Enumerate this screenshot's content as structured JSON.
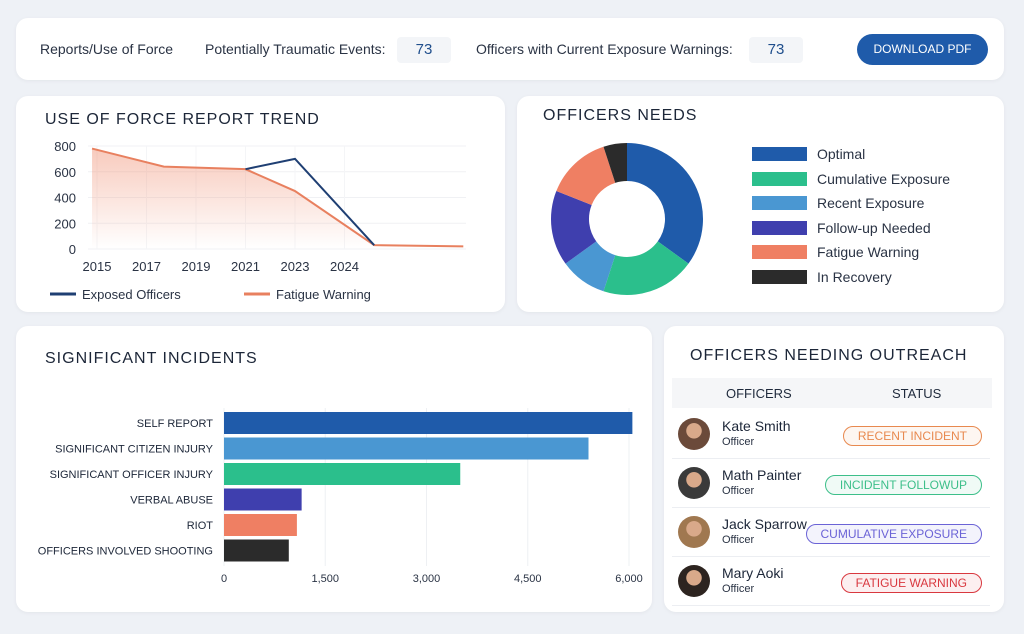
{
  "header": {
    "label": "Reports/Use of Force",
    "pte_label": "Potentially Traumatic Events:",
    "pte_value": "73",
    "exposure_label": "Officers with Current Exposure Warnings:",
    "exposure_value": "73",
    "download_label": "DOWNLOAD PDF"
  },
  "trend": {
    "title": "USE OF FORCE REPORT TREND"
  },
  "needs": {
    "title": "OFFICERS NEEDS"
  },
  "incidents": {
    "title": "SIGNIFICANT INCIDENTS"
  },
  "outreach": {
    "title": "OFFICERS NEEDING OUTREACH",
    "col_officers": "OFFICERS",
    "col_status": "STATUS",
    "rows": [
      {
        "name": "Kate Smith",
        "role": "Officer",
        "status": "RECENT INCIDENT",
        "color": "#e8894f"
      },
      {
        "name": "Math Painter",
        "role": "Officer",
        "status": "INCIDENT FOLLOWUP",
        "color": "#3dbf8a"
      },
      {
        "name": "Jack Sparrow",
        "role": "Officer",
        "status": "CUMULATIVE EXPOSURE",
        "color": "#6b63d6"
      },
      {
        "name": "Mary Aoki",
        "role": "Officer",
        "status": "FATIGUE WARNING",
        "color": "#d9383f"
      }
    ]
  },
  "chart_data": [
    {
      "type": "line",
      "x_tick_labels": [
        "2015",
        "2017",
        "2019",
        "2021",
        "2023",
        "2024"
      ],
      "ylim": [
        0,
        800
      ],
      "y_ticks": [
        0,
        200,
        400,
        600,
        800
      ],
      "legend": "bottom",
      "series": [
        {
          "name": "Exposed Officers",
          "color": "#1f3f73",
          "points": [
            [
              3,
              620
            ],
            [
              4,
              700
            ],
            [
              5.6,
              30
            ]
          ]
        },
        {
          "name": "Fatigue Warning",
          "color": "#e8805f",
          "area": true,
          "points": [
            [
              -0.1,
              780
            ],
            [
              1.35,
              640
            ],
            [
              3,
              620
            ],
            [
              4,
              450
            ],
            [
              5.6,
              30
            ],
            [
              7.4,
              20
            ]
          ]
        }
      ]
    },
    {
      "type": "pie",
      "donut": true,
      "legend": "right",
      "categories": [
        "Optimal",
        "Cumulative Exposure",
        "Recent Exposure",
        "Follow-up Needed",
        "Fatigue Warning",
        "In Recovery"
      ],
      "values": [
        35,
        20,
        10,
        16,
        14,
        5
      ],
      "colors": [
        "#1f5baa",
        "#2bbf8c",
        "#4a97d2",
        "#3f3fae",
        "#ef7f63",
        "#2b2b2b"
      ]
    },
    {
      "type": "bar",
      "orientation": "horizontal",
      "categories": [
        "SELF REPORT",
        "SIGNIFICANT CITIZEN INJURY",
        "SIGNIFICANT OFFICER INJURY",
        "VERBAL ABUSE",
        "RIOT",
        "OFFICERS INVOLVED SHOOTING"
      ],
      "values": [
        6050,
        5400,
        3500,
        1150,
        1080,
        960
      ],
      "colors": [
        "#1f5baa",
        "#4a97d2",
        "#2bbf8c",
        "#3f3fae",
        "#ef7f63",
        "#2b2b2b"
      ],
      "xlim": [
        0,
        6000
      ],
      "x_tick_labels": [
        "0",
        "1,500",
        "3,000",
        "4,500",
        "6,000"
      ],
      "grid": true
    }
  ]
}
